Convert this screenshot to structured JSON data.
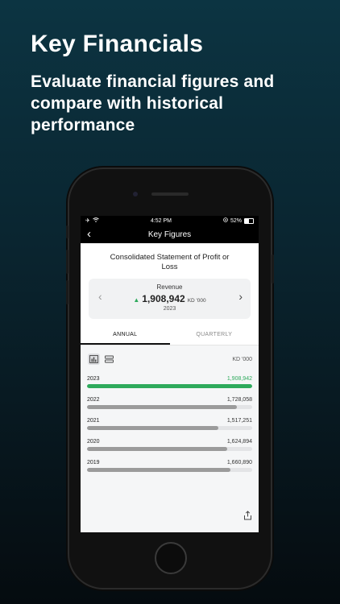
{
  "promo": {
    "headline": "Key Financials",
    "subheadline": "Evaluate financial figures and compare with historical performance"
  },
  "status_bar": {
    "time": "4:52 PM",
    "battery": "52%",
    "icons": [
      "airplane-icon",
      "wifi-icon",
      "orientation-lock-icon",
      "battery-icon"
    ]
  },
  "nav": {
    "title": "Key Figures",
    "back_icon": "chevron-left-icon"
  },
  "statement": {
    "title": "Consolidated Statement of Profit or Loss"
  },
  "metric": {
    "label": "Revenue",
    "value": "1,908,942",
    "unit": "KD '000",
    "year": "2023",
    "trend": "up"
  },
  "tabs": [
    {
      "label": "ANNUAL",
      "active": true
    },
    {
      "label": "QUARTERLY",
      "active": false
    }
  ],
  "chart": {
    "unit": "KD '000",
    "view_toggles": [
      "bar-chart-icon",
      "list-icon"
    ]
  },
  "chart_data": {
    "type": "bar",
    "orientation": "horizontal",
    "categories": [
      "2023",
      "2022",
      "2021",
      "2020",
      "2019"
    ],
    "value_labels": [
      "1,908,942",
      "1,728,058",
      "1,517,251",
      "1,624,894",
      "1,660,890"
    ],
    "values": [
      1908942,
      1728058,
      1517251,
      1624894,
      1660890
    ],
    "max": 1908942,
    "highlight_index": 0,
    "colors": {
      "highlight": "#2eaa5c",
      "default": "#9b9b9b",
      "track": "#e3e4e6"
    }
  }
}
